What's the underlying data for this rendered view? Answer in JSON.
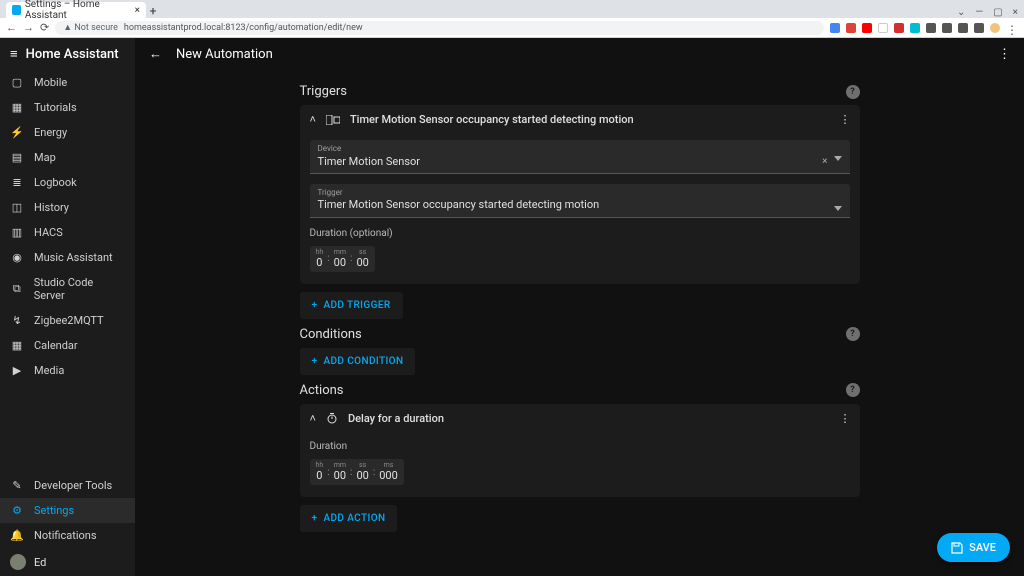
{
  "browser": {
    "tab_title": "Settings – Home Assistant",
    "not_secure": "Not secure",
    "url": "homeassistantprod.local:8123/config/automation/edit/new"
  },
  "app_title": "Home Assistant",
  "page_title": "New Automation",
  "sidebar": {
    "items": [
      {
        "icon": "▦",
        "label": "Mobile"
      },
      {
        "icon": "▦",
        "label": "Tutorials"
      },
      {
        "icon": "⚡",
        "label": "Energy"
      },
      {
        "icon": "🗺",
        "label": "Map"
      },
      {
        "icon": "≣",
        "label": "Logbook"
      },
      {
        "icon": "◷",
        "label": "History"
      },
      {
        "icon": "▤",
        "label": "HACS"
      },
      {
        "icon": "●",
        "label": "Music Assistant"
      },
      {
        "icon": "⌁",
        "label": "Studio Code Server"
      },
      {
        "icon": "↺",
        "label": "Zigbee2MQTT"
      },
      {
        "icon": "▦",
        "label": "Calendar"
      },
      {
        "icon": "▦",
        "label": "Media"
      }
    ],
    "dev_tools": "Developer Tools",
    "settings": "Settings",
    "notifications": "Notifications",
    "user": "Ed"
  },
  "sections": {
    "triggers": "Triggers",
    "conditions": "Conditions",
    "actions": "Actions"
  },
  "trigger": {
    "summary": "Timer Motion Sensor occupancy started detecting motion",
    "device_label": "Device",
    "device_value": "Timer Motion Sensor",
    "trigger_label": "Trigger",
    "trigger_value": "Timer Motion Sensor occupancy started detecting motion",
    "duration_label": "Duration (optional)",
    "duration": {
      "hh_u": "hh",
      "hh": "0",
      "mm_u": "mm",
      "mm": "00",
      "ss_u": "ss",
      "ss": "00"
    }
  },
  "action": {
    "summary": "Delay for a duration",
    "duration_label": "Duration",
    "duration": {
      "hh_u": "hh",
      "hh": "0",
      "mm_u": "mm",
      "mm": "00",
      "ss_u": "ss",
      "ss": "00",
      "ms_u": "ms",
      "ms": "000"
    }
  },
  "buttons": {
    "add_trigger": "ADD TRIGGER",
    "add_condition": "ADD CONDITION",
    "add_action": "ADD ACTION",
    "save": "SAVE"
  }
}
